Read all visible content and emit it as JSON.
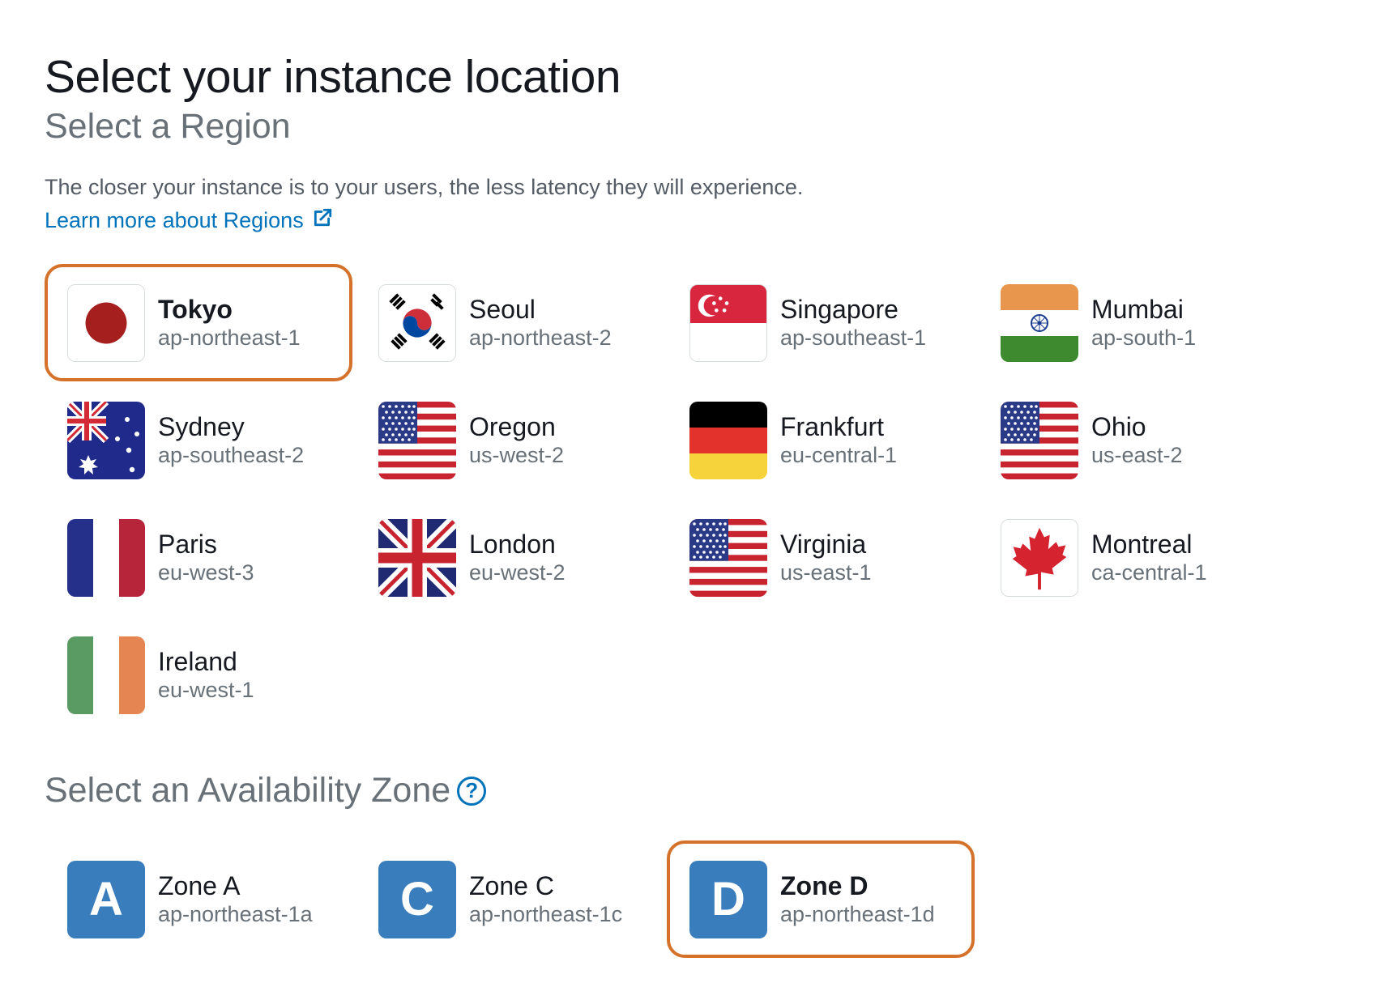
{
  "page": {
    "title": "Select your instance location",
    "region_heading": "Select a Region",
    "description": "The closer your instance is to your users, the less latency they will experience.",
    "learn_more_link": "Learn more about Regions",
    "zone_heading": "Select an Availability Zone"
  },
  "regions": [
    {
      "name": "Tokyo",
      "code": "ap-northeast-1",
      "flag": "japan-flag-icon",
      "selected": true
    },
    {
      "name": "Seoul",
      "code": "ap-northeast-2",
      "flag": "south-korea-flag-icon"
    },
    {
      "name": "Singapore",
      "code": "ap-southeast-1",
      "flag": "singapore-flag-icon"
    },
    {
      "name": "Mumbai",
      "code": "ap-south-1",
      "flag": "india-flag-icon"
    },
    {
      "name": "Sydney",
      "code": "ap-southeast-2",
      "flag": "australia-flag-icon"
    },
    {
      "name": "Oregon",
      "code": "us-west-2",
      "flag": "usa-flag-icon"
    },
    {
      "name": "Frankfurt",
      "code": "eu-central-1",
      "flag": "germany-flag-icon"
    },
    {
      "name": "Ohio",
      "code": "us-east-2",
      "flag": "usa-flag-icon"
    },
    {
      "name": "Paris",
      "code": "eu-west-3",
      "flag": "france-flag-icon"
    },
    {
      "name": "London",
      "code": "eu-west-2",
      "flag": "uk-flag-icon"
    },
    {
      "name": "Virginia",
      "code": "us-east-1",
      "flag": "usa-flag-icon"
    },
    {
      "name": "Montreal",
      "code": "ca-central-1",
      "flag": "canada-flag-icon"
    },
    {
      "name": "Ireland",
      "code": "eu-west-1",
      "flag": "ireland-flag-icon"
    }
  ],
  "zones": [
    {
      "letter": "A",
      "name": "Zone A",
      "code": "ap-northeast-1a"
    },
    {
      "letter": "C",
      "name": "Zone C",
      "code": "ap-northeast-1c"
    },
    {
      "letter": "D",
      "name": "Zone D",
      "code": "ap-northeast-1d",
      "selected": true
    }
  ],
  "colors": {
    "selected_border": "#d4722c",
    "link": "#0073bb",
    "zone_icon": "#3a7dbc"
  }
}
